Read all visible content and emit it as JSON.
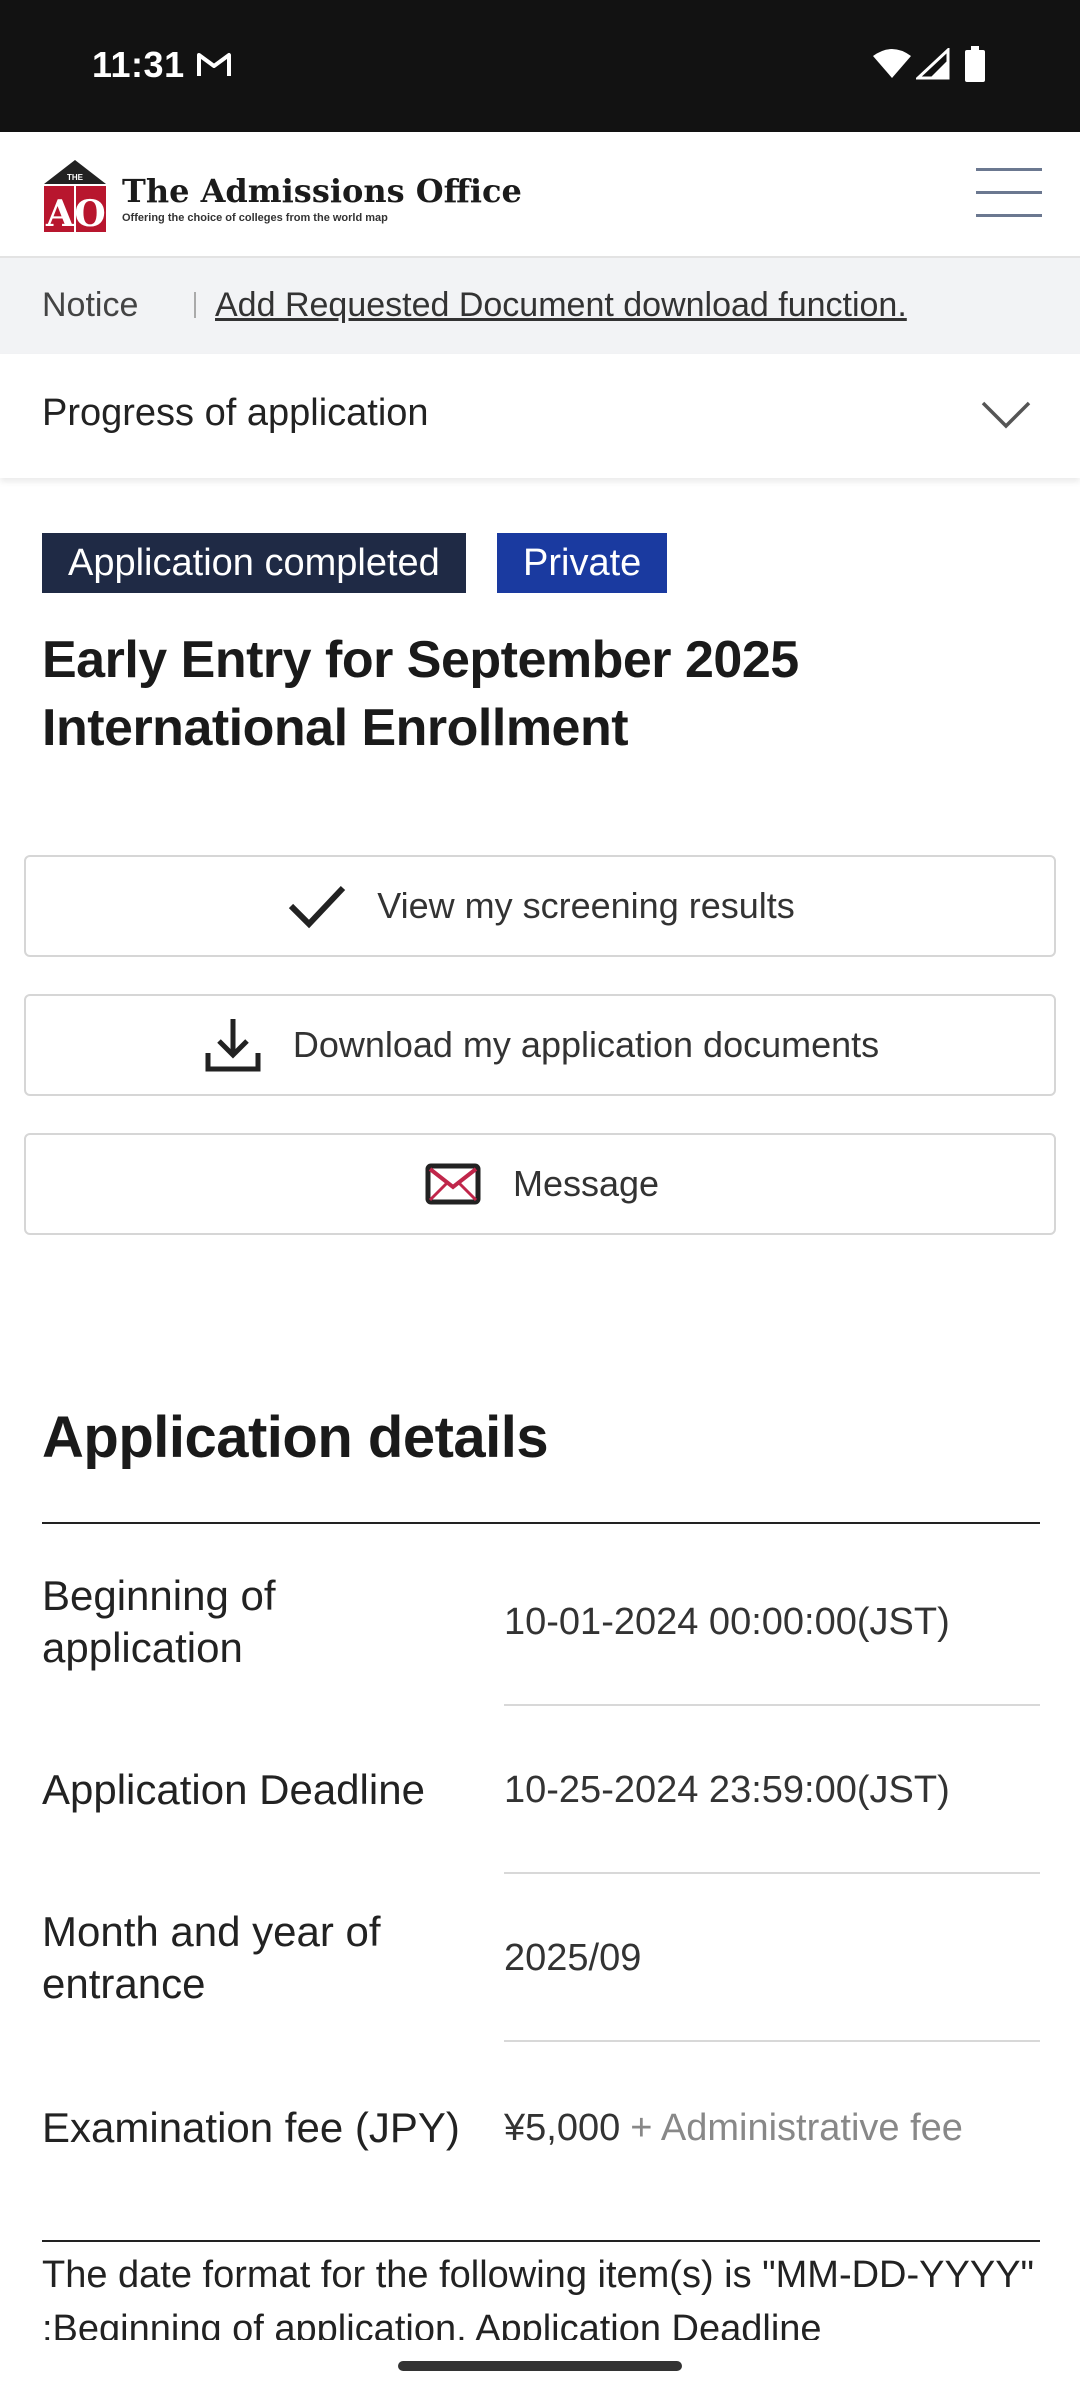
{
  "status_bar": {
    "time": "11:31",
    "icons": [
      "gmail-icon",
      "wifi-icon",
      "signal-icon",
      "battery-icon"
    ]
  },
  "header": {
    "logo_text": "THE AO",
    "brand": "The Admissions Office",
    "tagline": "Offering the choice of colleges from the world map",
    "menu_icon": "hamburger-menu-icon"
  },
  "notice": {
    "label": "Notice",
    "link_text": "Add Requested Document download function."
  },
  "progress": {
    "title": "Progress of application",
    "icon": "chevron-down-icon"
  },
  "badges": {
    "status": "Application completed",
    "visibility": "Private"
  },
  "application": {
    "title": "Early Entry for September 2025 International Enrollment"
  },
  "actions": {
    "screening": "View my screening results",
    "download": "Download my application documents",
    "message": "Message"
  },
  "details": {
    "heading": "Application details",
    "rows": [
      {
        "label": "Beginning of application",
        "value": "10-01-2024 00:00:00(JST)"
      },
      {
        "label": "Application Deadline",
        "value": "10-25-2024 23:59:00(JST)"
      },
      {
        "label": "Month and year of entrance",
        "value": "2025/09"
      },
      {
        "label": "Examination fee (JPY)",
        "value": "¥5,000",
        "extra": "+ Administrative fee"
      }
    ],
    "footnote": "The date format for the following item(s) is \"MM-DD-YYYY\" :Beginning of application, Application Deadline"
  },
  "colors": {
    "status_bar": "#121212",
    "badge_completed": "#1f2a45",
    "badge_private": "#1a3aa0",
    "mail_accent": "#c0264a"
  }
}
